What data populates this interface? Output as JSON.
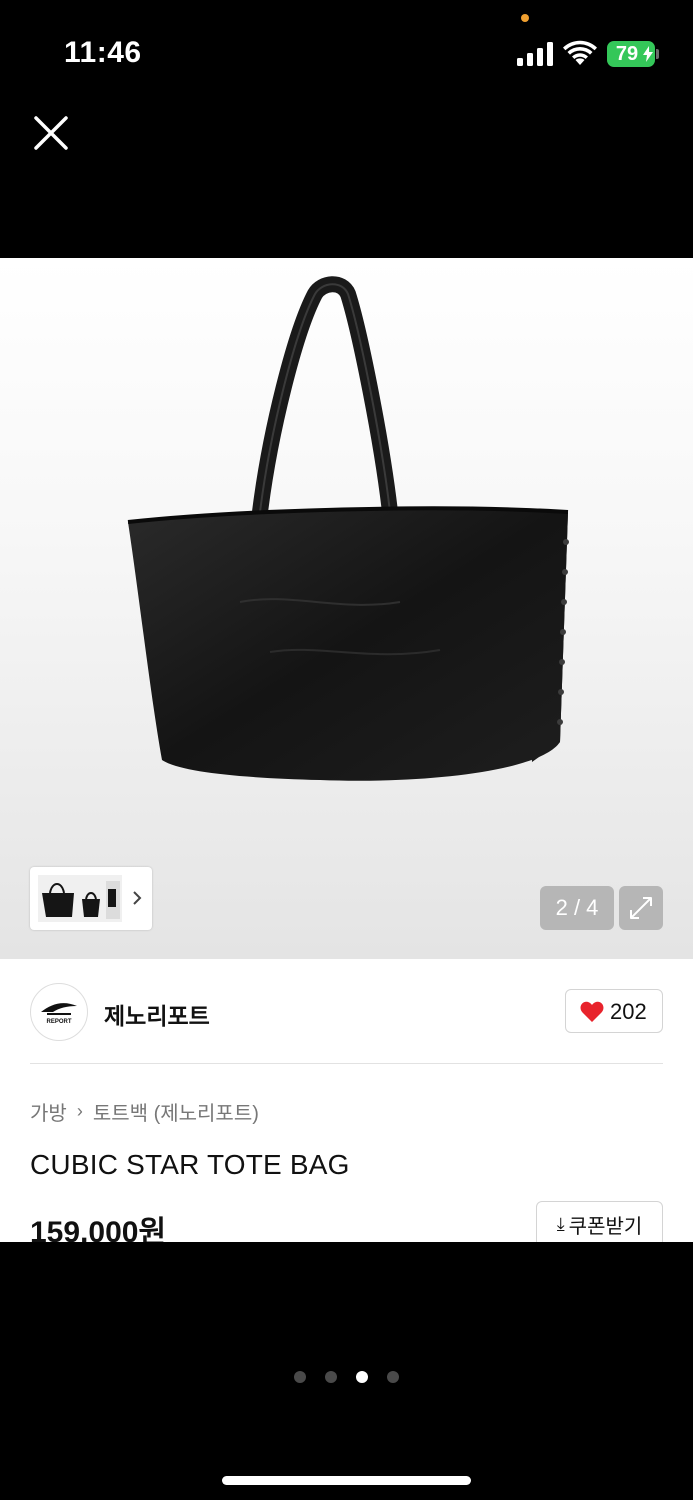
{
  "status_bar": {
    "time": "11:46",
    "battery": "79",
    "icons": [
      "cellular-signal-icon",
      "wifi-icon",
      "battery-charging-icon"
    ]
  },
  "nav": {
    "close_icon": "close-icon"
  },
  "gallery": {
    "counter": "2 / 4",
    "current_index": 2,
    "total": 4,
    "expand_icon": "expand-icon",
    "thumbnail_chevron_icon": "chevron-right-icon"
  },
  "brand": {
    "name": "제노리포트",
    "logo_text": "REPORT"
  },
  "like": {
    "count": "202",
    "icon": "heart-icon",
    "color": "#e8232c"
  },
  "breadcrumb": {
    "items": [
      "가방",
      "토트백 (제노리포트)"
    ],
    "separator_icon": "chevron-right-icon"
  },
  "product": {
    "title": "CUBIC STAR TOTE BAG",
    "price": "159,000원"
  },
  "coupon": {
    "label": "쿠폰받기",
    "icon": "download-icon"
  },
  "pager": {
    "count": 4,
    "active": 2
  },
  "colors": {
    "battery_green": "#34c759",
    "background": "#000000",
    "counter_bg": "#b6b6b6"
  }
}
